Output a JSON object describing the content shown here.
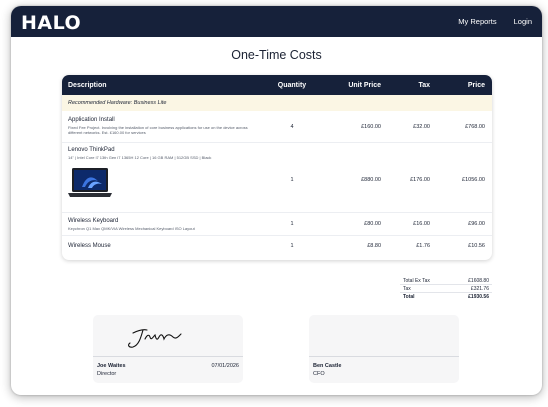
{
  "header": {
    "logo": "HALO",
    "nav": [
      "My Reports",
      "Login"
    ]
  },
  "page_title": "One-Time Costs",
  "table": {
    "columns": [
      "Description",
      "Quantity",
      "Unit Price",
      "Tax",
      "Price"
    ],
    "section": "Recommended Hardware: Business Lite",
    "rows": [
      {
        "name": "Application Install",
        "sub": "Fixed Fee Project. Involving the installation of core business applications for use on the device across different networks. Est. £160.00 for services",
        "qty": "4",
        "unit": "£160.00",
        "tax": "£32.00",
        "price": "£768.00"
      },
      {
        "name": "Lenovo ThinkPad",
        "sub": "14\" | Intel Core i7 13th Gen i7 1365H 12 Core | 16 GB RAM | 512GB SSD | Black",
        "qty": "1",
        "unit": "£880.00",
        "tax": "£176.00",
        "price": "£1056.00"
      },
      {
        "name": "Wireless Keyboard",
        "sub": "Keychron Q1 Max QMK/VIA Wireless Mechanical Keyboard ISO Layout",
        "qty": "1",
        "unit": "£80.00",
        "tax": "£16.00",
        "price": "£96.00"
      },
      {
        "name": "Wireless Mouse",
        "sub": "",
        "qty": "1",
        "unit": "£8.80",
        "tax": "£1.76",
        "price": "£10.56"
      }
    ]
  },
  "totals": [
    {
      "label": "Total Ex Tax",
      "value": "£1608.80"
    },
    {
      "label": "Tax",
      "value": "£321.76"
    },
    {
      "label": "Total",
      "value": "£1930.56"
    }
  ],
  "signatures": [
    {
      "name": "Joe Waites",
      "role": "Director",
      "date": "07/01/2026",
      "signed": true
    },
    {
      "name": "Ben Castle",
      "role": "CFO",
      "date": "",
      "signed": false
    }
  ]
}
